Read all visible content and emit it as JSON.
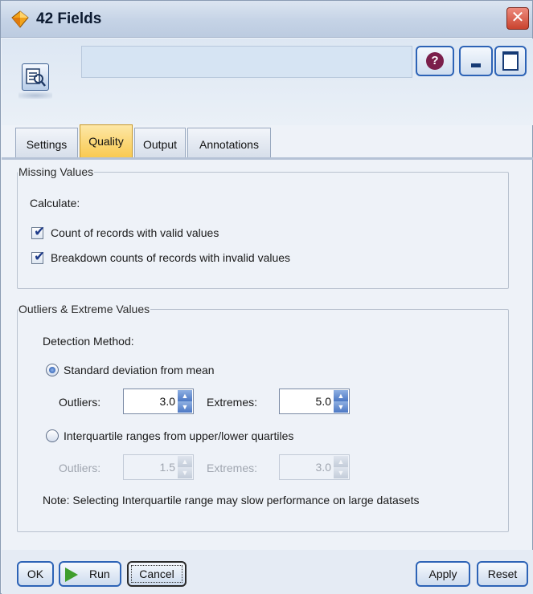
{
  "window": {
    "title": "42 Fields",
    "close_glyph": "✕",
    "icon": "diamond-app-icon"
  },
  "header": {
    "node_icon": "data-audit-node-icon",
    "name_value": "",
    "help_glyph": "?",
    "help_icon": "help-icon",
    "minimize_icon": "minimize-icon",
    "maximize_icon": "maximize-icon"
  },
  "tabs": [
    {
      "label": "Settings",
      "active": false
    },
    {
      "label": "Quality",
      "active": true
    },
    {
      "label": "Output",
      "active": false
    },
    {
      "label": "Annotations",
      "active": false
    }
  ],
  "missing_values": {
    "legend": "Missing Values",
    "calculate_label": "Calculate:",
    "options": [
      {
        "label": "Count of records with valid values",
        "checked": true
      },
      {
        "label": "Breakdown counts of records with invalid values",
        "checked": true
      }
    ]
  },
  "outliers": {
    "legend": "Outliers & Extreme Values",
    "detection_label": "Detection Method:",
    "methods": [
      {
        "label": "Standard deviation from mean",
        "selected": true,
        "outliers_label": "Outliers:",
        "outliers_value": "3.0",
        "extremes_label": "Extremes:",
        "extremes_value": "5.0",
        "enabled": true
      },
      {
        "label": "Interquartile ranges from upper/lower quartiles",
        "selected": false,
        "outliers_label": "Outliers:",
        "outliers_value": "1.5",
        "extremes_label": "Extremes:",
        "extremes_value": "3.0",
        "enabled": false
      }
    ],
    "note": "Note: Selecting Interquartile range may slow performance on large datasets"
  },
  "buttons": {
    "ok": "OK",
    "run": "Run",
    "cancel": "Cancel",
    "apply": "Apply",
    "reset": "Reset"
  },
  "colors": {
    "accent_blue": "#2d63b6",
    "active_tab": "#f9c94f",
    "close_red": "#c9432e",
    "run_green": "#3f9e2c"
  }
}
